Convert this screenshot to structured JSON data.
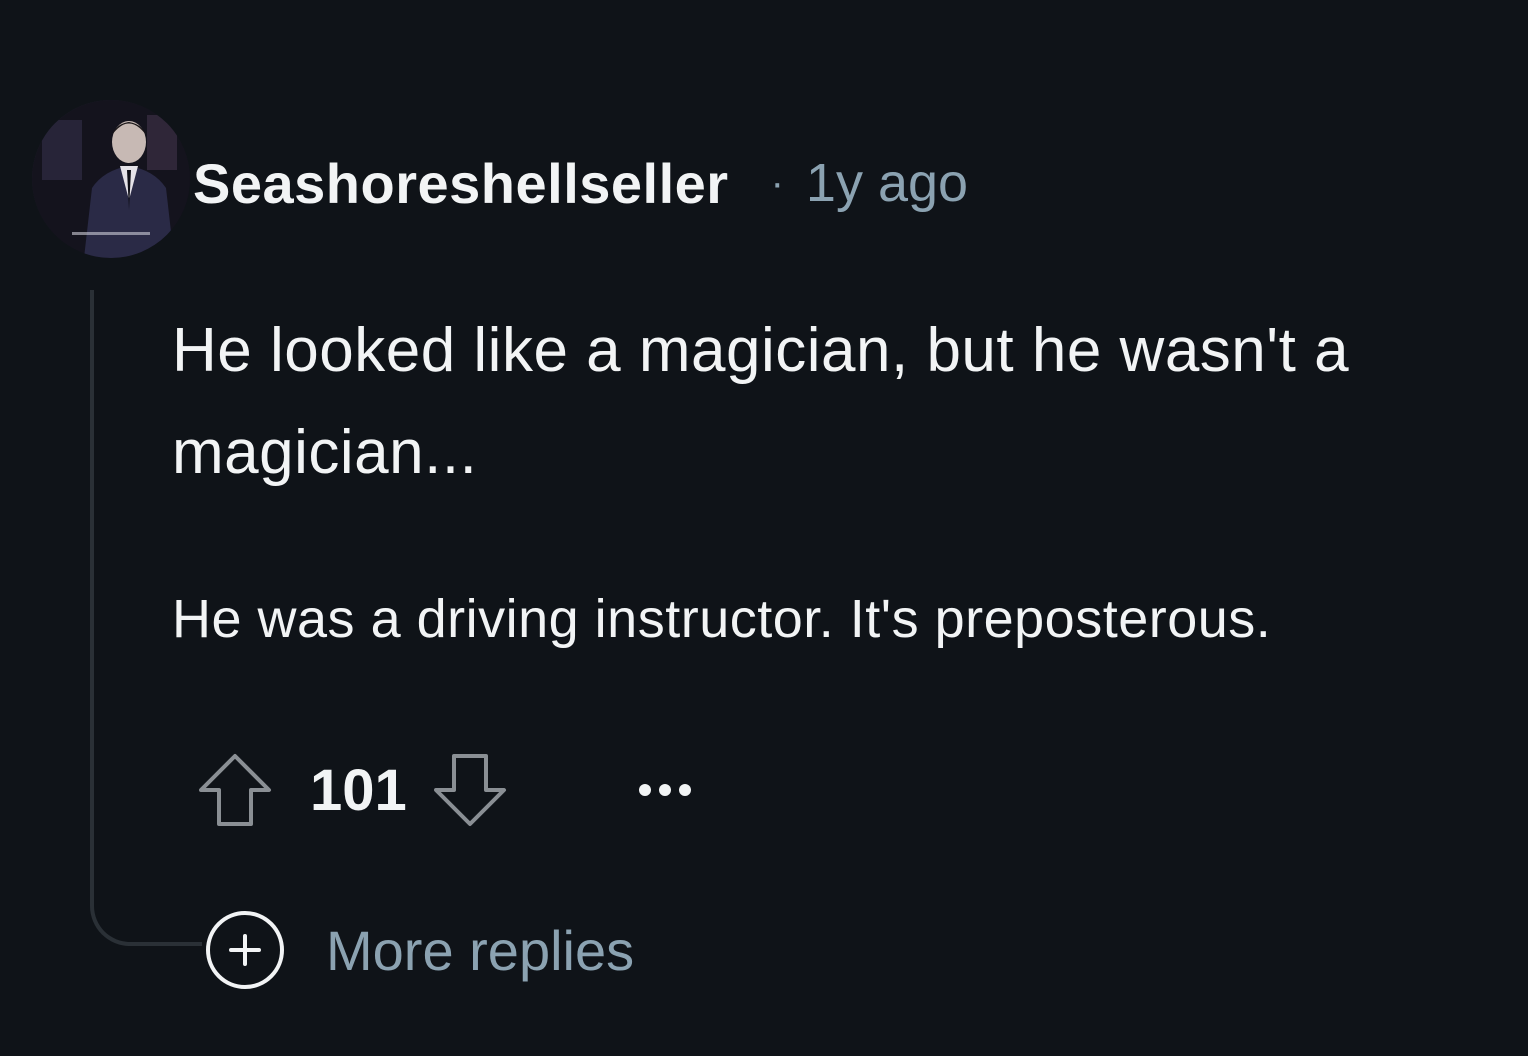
{
  "comment": {
    "username": "Seashoreshellseller",
    "separator": "·",
    "time": "1y ago",
    "body_p1": "He looked like a magician, but he wasn't a magician...",
    "body_p2": "He was a driving instructor. It's preposterous.",
    "score": "101",
    "more_icon": "ellipsis-icon",
    "more_replies_label": "More replies"
  },
  "colors": {
    "background": "#0f1318",
    "text": "#f2f4f5",
    "muted": "#8ba2b1",
    "thread_line": "#2a3036"
  },
  "icons": {
    "upvote": "arrow-up-outline-icon",
    "downvote": "arrow-down-outline-icon",
    "expand": "plus-circle-icon"
  }
}
